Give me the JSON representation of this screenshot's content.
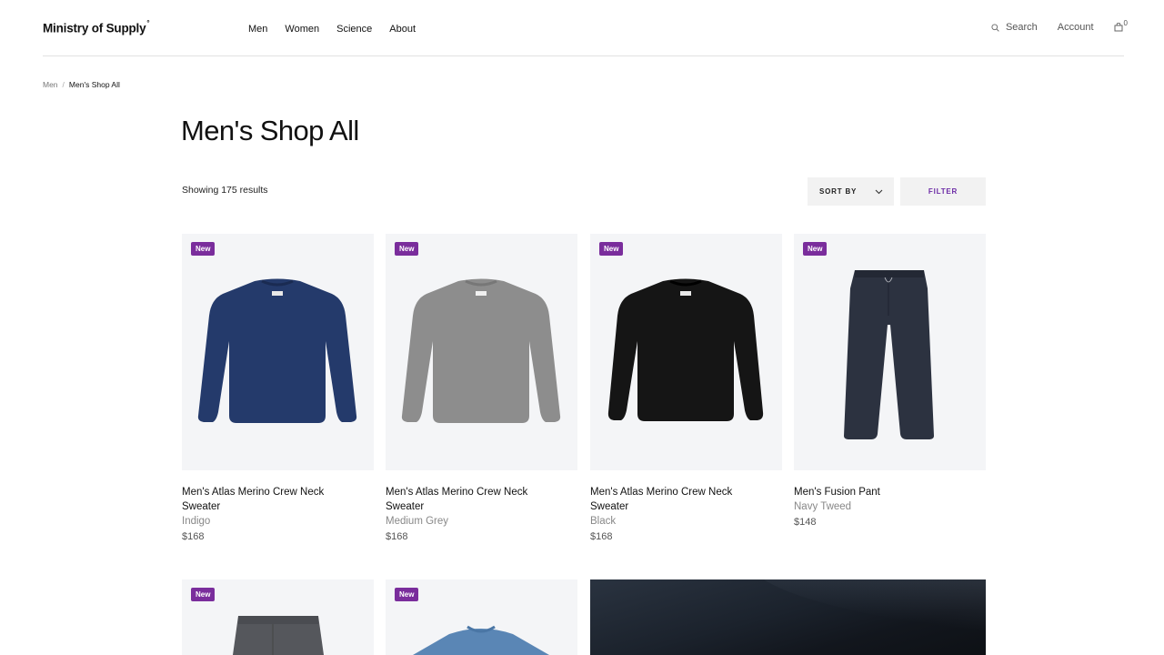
{
  "brand": {
    "logo": "Ministry of Supply",
    "logo_mark": "°"
  },
  "nav": [
    "Men",
    "Women",
    "Science",
    "About"
  ],
  "utility": {
    "search_label": "Search",
    "account_label": "Account",
    "cart_count": "0"
  },
  "breadcrumb": {
    "parent": "Men",
    "separator": "/",
    "current": "Men's Shop All"
  },
  "page": {
    "title": "Men's Shop All",
    "results_text": "Showing 175 results"
  },
  "controls": {
    "sort_label": "SORT BY",
    "filter_label": "FILTER"
  },
  "colors": {
    "accent_purple": "#7a2d9c",
    "filter_text": "#6c2ba6",
    "image_bg": "#f4f5f7"
  },
  "products": [
    {
      "badge": "New",
      "name_line1": "Men's Atlas Merino Crew Neck",
      "name_line2": "Sweater",
      "color": "Indigo",
      "price": "$168",
      "swatch": "#243a6b"
    },
    {
      "badge": "New",
      "name_line1": "Men's Atlas Merino Crew Neck",
      "name_line2": "Sweater",
      "color": "Medium Grey",
      "price": "$168",
      "swatch": "#8d8d8d"
    },
    {
      "badge": "New",
      "name_line1": "Men's Atlas Merino Crew Neck",
      "name_line2": "Sweater",
      "color": "Black",
      "price": "$168",
      "swatch": "#151515"
    },
    {
      "badge": "New",
      "name_line1": "Men's Fusion Pant",
      "name_line2": "",
      "color": "Navy Tweed",
      "price": "$148",
      "swatch": "#2c3240"
    }
  ],
  "row2": [
    {
      "badge": "New",
      "swatch": "#55575c"
    },
    {
      "badge": "New",
      "swatch": "#5a86b5"
    }
  ]
}
